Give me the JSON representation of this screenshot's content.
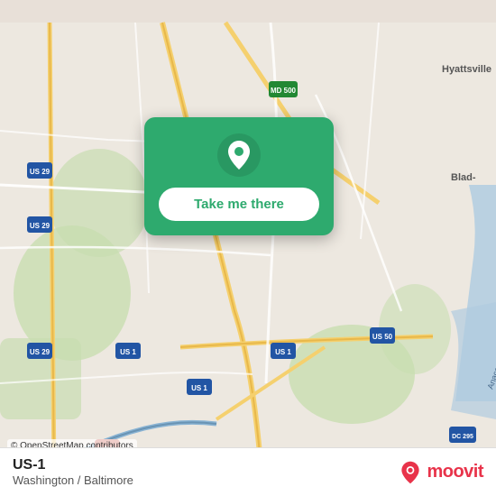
{
  "map": {
    "background_color": "#e8e0d8",
    "osm_attribution": "© OpenStreetMap contributors"
  },
  "popup": {
    "button_label": "Take me there",
    "pin_color": "#ffffff",
    "background_color": "#2eaa6e"
  },
  "bottom_bar": {
    "route_name": "US-1",
    "route_location": "Washington / Baltimore",
    "moovit_label": "moovit"
  }
}
